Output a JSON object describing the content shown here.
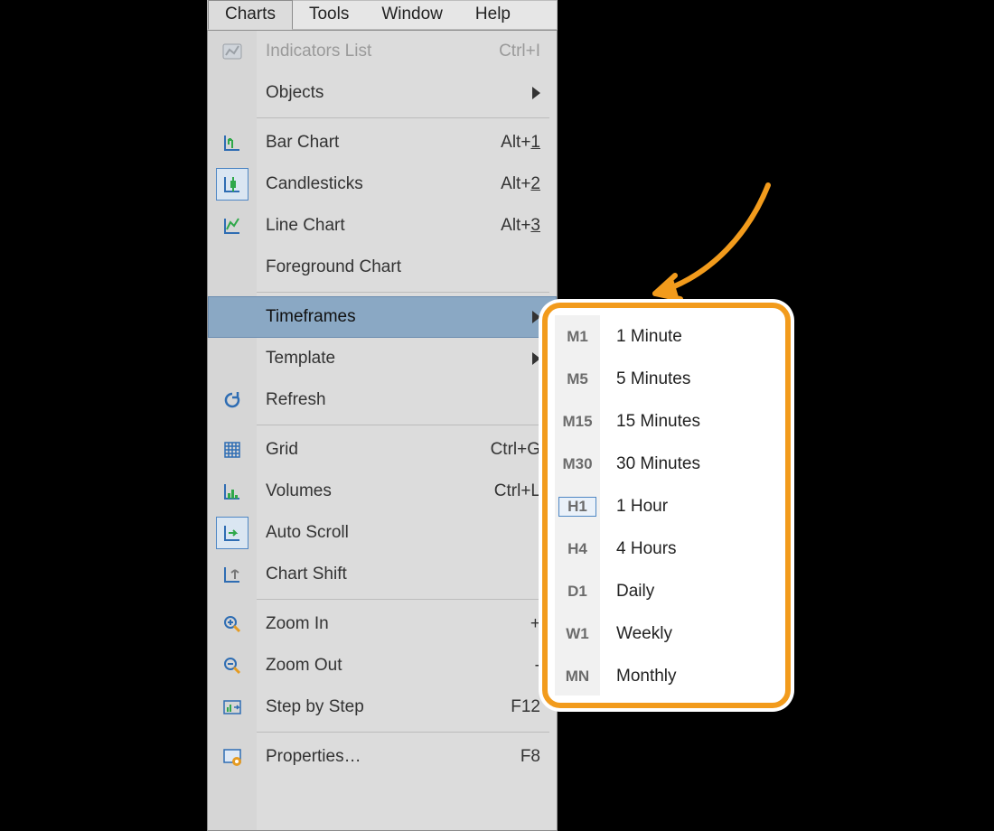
{
  "menubar": {
    "items": [
      "Charts",
      "Tools",
      "Window",
      "Help"
    ],
    "active_index": 0
  },
  "menu": [
    {
      "type": "item",
      "icon": "indicators",
      "label": "Indicators List",
      "shortcut": "Ctrl+I",
      "disabled": true
    },
    {
      "type": "item",
      "icon": "",
      "label": "Objects",
      "submenu": true
    },
    {
      "type": "sep"
    },
    {
      "type": "item",
      "icon": "barchart",
      "label": "Bar Chart",
      "shortcut_prefix": "Alt+",
      "shortcut_u": "1"
    },
    {
      "type": "item",
      "icon": "candle",
      "label": "Candlesticks",
      "shortcut_prefix": "Alt+",
      "shortcut_u": "2",
      "selected": true
    },
    {
      "type": "item",
      "icon": "line",
      "label": "Line Chart",
      "shortcut_prefix": "Alt+",
      "shortcut_u": "3"
    },
    {
      "type": "item",
      "icon": "",
      "label": "Foreground Chart"
    },
    {
      "type": "sep"
    },
    {
      "type": "item",
      "icon": "",
      "label": "Timeframes",
      "submenu": true,
      "hover": true
    },
    {
      "type": "item",
      "icon": "",
      "label": "Template",
      "submenu": true
    },
    {
      "type": "item",
      "icon": "refresh",
      "label": "Refresh"
    },
    {
      "type": "sep"
    },
    {
      "type": "item",
      "icon": "grid",
      "label": "Grid",
      "shortcut": "Ctrl+G"
    },
    {
      "type": "item",
      "icon": "volumes",
      "label": "Volumes",
      "shortcut": "Ctrl+L"
    },
    {
      "type": "item",
      "icon": "autoscroll",
      "label": "Auto Scroll",
      "selected": true
    },
    {
      "type": "item",
      "icon": "chartshift",
      "label": "Chart Shift"
    },
    {
      "type": "sep"
    },
    {
      "type": "item",
      "icon": "zoomin",
      "label": "Zoom In",
      "shortcut": "+"
    },
    {
      "type": "item",
      "icon": "zoomout",
      "label": "Zoom Out",
      "shortcut": "-"
    },
    {
      "type": "item",
      "icon": "step",
      "label": "Step by Step",
      "shortcut": "F12"
    },
    {
      "type": "sep"
    },
    {
      "type": "item",
      "icon": "props",
      "label": "Properties…",
      "shortcut": "F8"
    }
  ],
  "timeframes": [
    {
      "code": "M1",
      "label": "1 Minute"
    },
    {
      "code": "M5",
      "label": "5 Minutes"
    },
    {
      "code": "M15",
      "label": "15 Minutes"
    },
    {
      "code": "M30",
      "label": "30 Minutes"
    },
    {
      "code": "H1",
      "label": "1 Hour",
      "selected": true
    },
    {
      "code": "H4",
      "label": "4 Hours"
    },
    {
      "code": "D1",
      "label": "Daily"
    },
    {
      "code": "W1",
      "label": "Weekly"
    },
    {
      "code": "MN",
      "label": "Monthly"
    }
  ]
}
